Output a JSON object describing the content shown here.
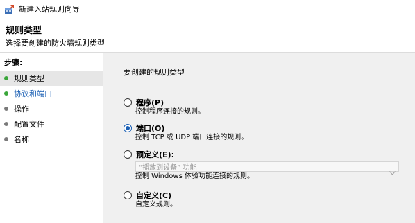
{
  "window": {
    "title": "新建入站规则向导"
  },
  "header": {
    "title": "规则类型",
    "subtitle": "选择要创建的防火墙规则类型"
  },
  "steps": {
    "header": "步骤:",
    "items": [
      {
        "label": "规则类型"
      },
      {
        "label": "协议和端口"
      },
      {
        "label": "操作"
      },
      {
        "label": "配置文件"
      },
      {
        "label": "名称"
      }
    ]
  },
  "content": {
    "heading": "要创建的规则类型",
    "options": [
      {
        "title": "程序(P)",
        "description": "控制程序连接的规则。",
        "checked": false
      },
      {
        "title": "端口(O)",
        "description": "控制 TCP 或 UDP 端口连接的规则。",
        "checked": true
      },
      {
        "title": "预定义(E):",
        "dropdown_value": "“播放到设备” 功能",
        "description": "控制 Windows 体验功能连接的规则。",
        "checked": false
      },
      {
        "title": "自定义(C)",
        "description": "自定义规则。",
        "checked": false
      }
    ]
  },
  "colors": {
    "accent": "#1a5fb4",
    "step_done": "#3aa63a",
    "content_bg": "#f0f0f0"
  },
  "icons": {
    "app": "firewall-wizard-icon",
    "dropdown": "chevron-down-icon"
  }
}
